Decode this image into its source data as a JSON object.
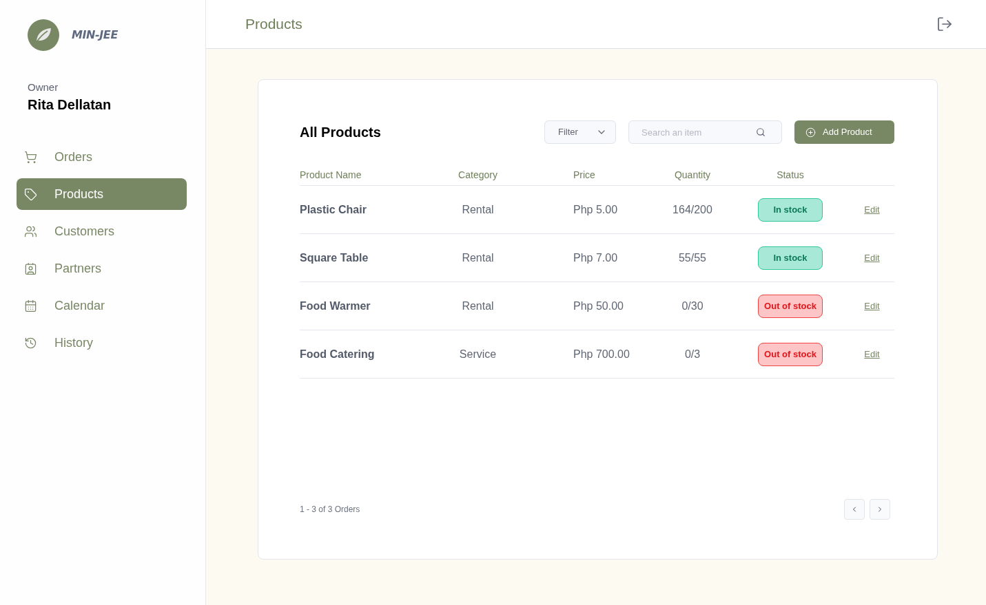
{
  "sidebar": {
    "brand": "MIN-JEE",
    "role": "Owner",
    "user": "Rita Dellatan",
    "nav": [
      {
        "label": "Orders",
        "selected": false
      },
      {
        "label": "Products",
        "selected": true
      },
      {
        "label": "Customers",
        "selected": false
      },
      {
        "label": "Partners",
        "selected": false
      },
      {
        "label": "Calendar",
        "selected": false
      },
      {
        "label": "History",
        "selected": false
      }
    ]
  },
  "header": {
    "title": "Products"
  },
  "card": {
    "title": "All Products",
    "filter": {
      "label": "Filter"
    },
    "search": {
      "placeholder": "Search an item"
    },
    "add_button": "Add Product"
  },
  "table": {
    "columns": [
      "Product Name",
      "Category",
      "Price",
      "Quantity",
      "Status"
    ],
    "rows": [
      {
        "name": "Plastic Chair",
        "category": "Rental",
        "price": "Php 5.00",
        "quantity": "164/200",
        "status": {
          "label": "In stock",
          "kind": "in"
        },
        "action": "Edit"
      },
      {
        "name": "Square Table",
        "category": "Rental",
        "price": "Php 7.00",
        "quantity": "55/55",
        "status": {
          "label": "In stock",
          "kind": "in"
        },
        "action": "Edit"
      },
      {
        "name": "Food Warmer",
        "category": "Rental",
        "price": "Php 50.00",
        "quantity": "0/30",
        "status": {
          "label": "Out of stock",
          "kind": "out"
        },
        "action": "Edit"
      },
      {
        "name": "Food Catering",
        "category": "Service",
        "price": "Php 700.00",
        "quantity": "0/3",
        "status": {
          "label": "Out of stock",
          "kind": "out"
        },
        "action": "Edit"
      }
    ]
  },
  "footer": {
    "summary": "1 - 3 of 3 Orders"
  }
}
